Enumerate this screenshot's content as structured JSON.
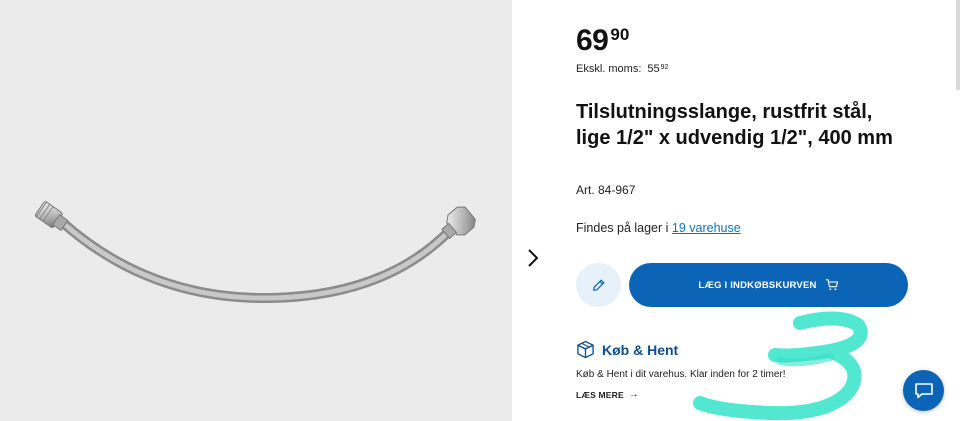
{
  "price": {
    "integer": "69",
    "decimal": "90"
  },
  "excl_vat": {
    "label": "Ekskl. moms:",
    "integer": "55",
    "decimal": "92"
  },
  "product": {
    "title": "Tilslutningsslange, rustfrit stål, lige 1/2\" x udvendig 1/2\", 400 mm",
    "article": "Art. 84-967"
  },
  "stock": {
    "prefix": "Findes på lager i ",
    "link": "19 varehuse"
  },
  "buttons": {
    "add_to_cart": "LÆG I INDKØBSKURVEN"
  },
  "click_collect": {
    "title": "Køb & Hent",
    "text": "Køb & Hent i dit varehus. Klar inden for 2 timer!",
    "read_more": "LÆS MERE"
  },
  "icons": {
    "next": "chevron-right-icon",
    "edit": "pencil-icon",
    "cart": "cart-icon",
    "box": "box-icon",
    "arrow": "arrow-right-icon",
    "chat": "chat-icon"
  },
  "colors": {
    "primary": "#0b64b5",
    "link": "#1570b8",
    "edit_bg": "#e6f1fa",
    "image_bg": "#ebebeb",
    "scribble": "#34e3c8"
  }
}
